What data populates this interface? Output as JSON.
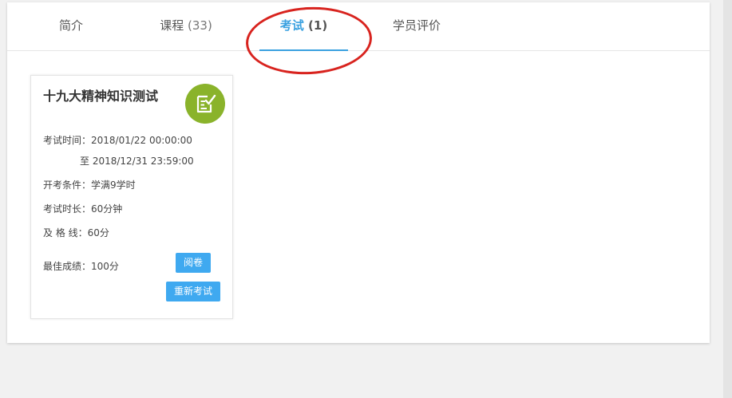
{
  "tabs": [
    {
      "label": "简介",
      "count": ""
    },
    {
      "label": "课程",
      "count": "(33)"
    },
    {
      "label": "考试",
      "count": "(1)"
    },
    {
      "label": "学员评价",
      "count": ""
    }
  ],
  "active_tab": "考试",
  "exam": {
    "title": "十九大精神知识测试",
    "icon": "exam-paper-check-icon",
    "time_label": "考试时间：",
    "time_start": "2018/01/22 00:00:00",
    "time_to": "至 2018/12/31 23:59:00",
    "condition_label": "开考条件：",
    "condition_value": "学满9学时",
    "duration_label": "考试时长：",
    "duration_value": "60分钟",
    "pass_label": "及 格 线：",
    "pass_value": "60分",
    "best_label": "最佳成绩：",
    "best_value": "100分",
    "review_button": "阅卷",
    "retake_button": "重新考试"
  },
  "colors": {
    "accent": "#3aa1e0",
    "button": "#3fa9f0",
    "icon_bg": "#8ab32b",
    "annotation": "#d8231e"
  }
}
